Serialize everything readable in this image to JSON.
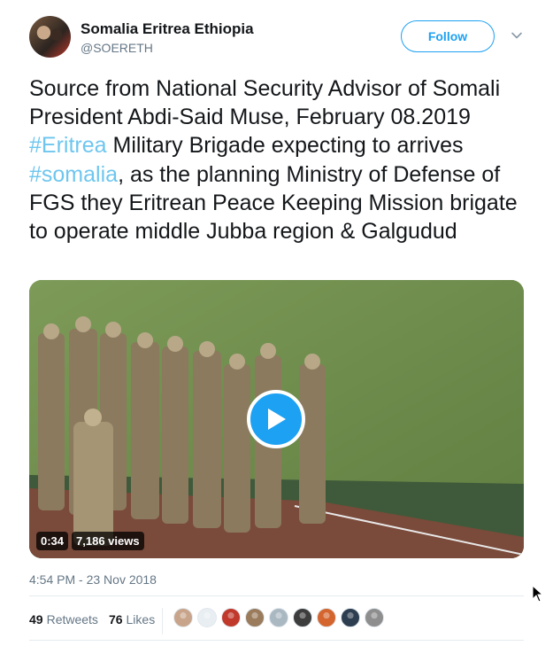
{
  "tweet": {
    "author_name": "Somalia Eritrea Ethiopia",
    "author_handle": "@SOERETH",
    "follow_label": "Follow",
    "text_segments": [
      {
        "text": "Source from National Security Advisor of Somali President  Abdi-Said Muse, February 08.2019 ",
        "hashtag": false
      },
      {
        "text": "#Eritrea",
        "hashtag": true
      },
      {
        "text": " Military Brigade expecting to arrives ",
        "hashtag": false
      },
      {
        "text": "#somalia",
        "hashtag": true
      },
      {
        "text": ", as the planning Ministry of Defense of FGS they Eritrean Peace Keeping Mission brigate to operate middle Jubba region & Galgudud",
        "hashtag": false
      }
    ],
    "timestamp": "4:54 PM - 23 Nov 2018"
  },
  "video": {
    "duration": "0:34",
    "views": "7,186 views"
  },
  "engagement": {
    "retweets_count": "49",
    "retweets_label": "Retweets",
    "likes_count": "76",
    "likes_label": "Likes",
    "liker_avatar_colors": [
      "#c8a48a",
      "#e8eef2",
      "#c0392b",
      "#9a7b5c",
      "#aab8c2",
      "#3d3d3d",
      "#d4652f",
      "#2c3e50",
      "#8e8e8e"
    ]
  },
  "colors": {
    "accent": "#1da1f2",
    "hashtag": "#6ec6ef",
    "muted": "#657786",
    "text": "#14171a"
  }
}
